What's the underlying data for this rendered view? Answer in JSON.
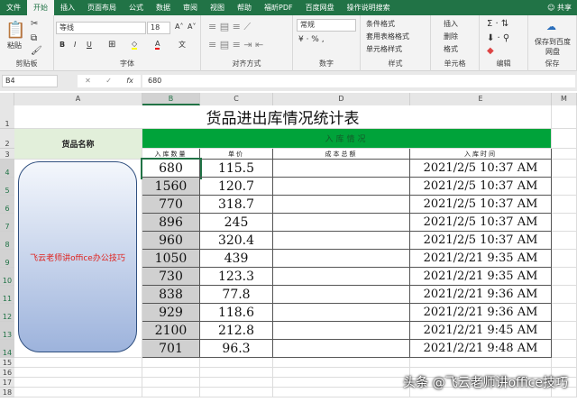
{
  "tabs": [
    "文件",
    "开始",
    "插入",
    "页面布局",
    "公式",
    "数据",
    "审阅",
    "视图",
    "帮助",
    "福昕PDF",
    "百度网盘"
  ],
  "tell_me": "操作说明搜索",
  "share": "共享",
  "ribbon": {
    "paste": "粘贴",
    "clipboard": "剪贴板",
    "font_name": "等线",
    "font_size": "18",
    "font_group": "字体",
    "bold": "B",
    "italic": "I",
    "underline": "U",
    "align_group": "对齐方式",
    "number_format": "常规",
    "number_group": "数字",
    "cond_format": "条件格式",
    "table_format": "套用表格格式",
    "cell_style": "单元格样式",
    "style_group": "样式",
    "insert": "插入",
    "delete": "删除",
    "format": "格式",
    "cells_group": "单元格",
    "edit_group": "编辑",
    "save_baidu": "保存到百度网盘",
    "save_group": "保存"
  },
  "formula_bar": {
    "name_box": "B4",
    "fx": "fx",
    "value": "680"
  },
  "columns": [
    "A",
    "B",
    "C",
    "D",
    "E",
    "M"
  ],
  "rows": [
    "1",
    "2",
    "3",
    "4",
    "5",
    "6",
    "7",
    "8",
    "9",
    "10",
    "11",
    "12",
    "13",
    "14",
    "15",
    "16",
    "17",
    "18"
  ],
  "sheet": {
    "title": "货品进出库情况统计表",
    "name_header": "货品名称",
    "group_header": "入库情况",
    "headers": [
      "入库数量",
      "单价",
      "成本总额",
      "入库时间"
    ],
    "product": "飞云老师讲office办公技巧",
    "data": [
      [
        "680",
        "115.5",
        "",
        "2021/2/5 10:37 AM"
      ],
      [
        "1560",
        "120.7",
        "",
        "2021/2/5 10:37 AM"
      ],
      [
        "770",
        "318.7",
        "",
        "2021/2/5 10:37 AM"
      ],
      [
        "896",
        "245",
        "",
        "2021/2/5 10:37 AM"
      ],
      [
        "960",
        "320.4",
        "",
        "2021/2/5 10:37 AM"
      ],
      [
        "1050",
        "439",
        "",
        "2021/2/21 9:35 AM"
      ],
      [
        "730",
        "123.3",
        "",
        "2021/2/21 9:35 AM"
      ],
      [
        "838",
        "77.8",
        "",
        "2021/2/21 9:36 AM"
      ],
      [
        "929",
        "118.6",
        "",
        "2021/2/21 9:36 AM"
      ],
      [
        "2100",
        "212.8",
        "",
        "2021/2/21 9:45 AM"
      ],
      [
        "701",
        "96.3",
        "",
        "2021/2/21 9:48 AM"
      ]
    ]
  },
  "watermark": "头条 @飞云老师讲office技巧",
  "colors": {
    "accent": "#217346",
    "header_green": "#00a33a",
    "name_bg": "#e2efda"
  }
}
